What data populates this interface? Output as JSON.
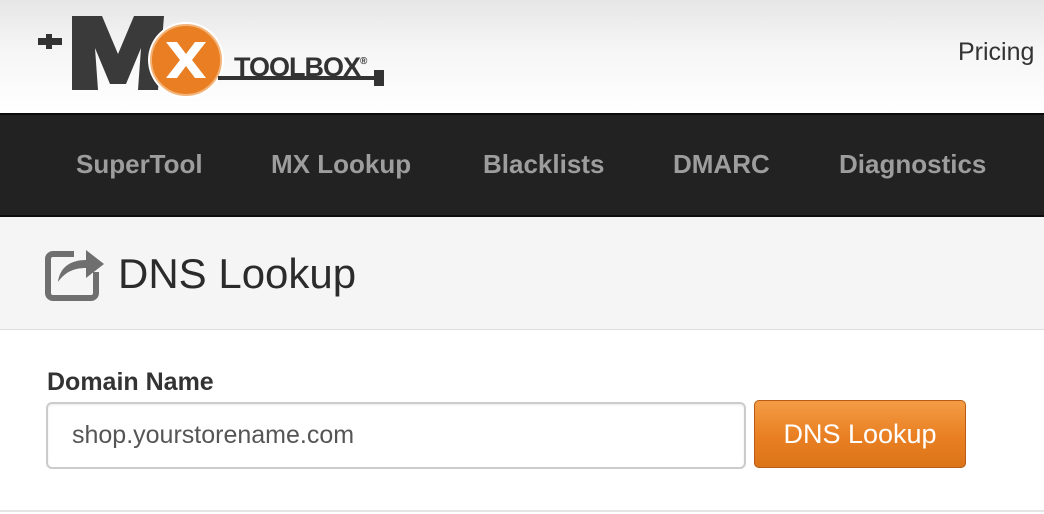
{
  "header": {
    "logo_text": "TOOLBOX",
    "logo_mark": "®",
    "logo_letters": "MX",
    "pricing_label": "Pricing"
  },
  "nav": {
    "items": [
      {
        "label": "SuperTool"
      },
      {
        "label": "MX Lookup"
      },
      {
        "label": "Blacklists"
      },
      {
        "label": "DMARC"
      },
      {
        "label": "Diagnostics"
      }
    ]
  },
  "page": {
    "title": "DNS Lookup",
    "title_icon": "share-arrow-icon"
  },
  "form": {
    "label": "Domain Name",
    "domain_value": "shop.yourstorename.com",
    "button_label": "DNS Lookup"
  },
  "colors": {
    "nav_background": "#222222",
    "nav_text": "#9d9d9d",
    "accent_orange": "#e97f22",
    "title_band": "#f5f5f5"
  }
}
